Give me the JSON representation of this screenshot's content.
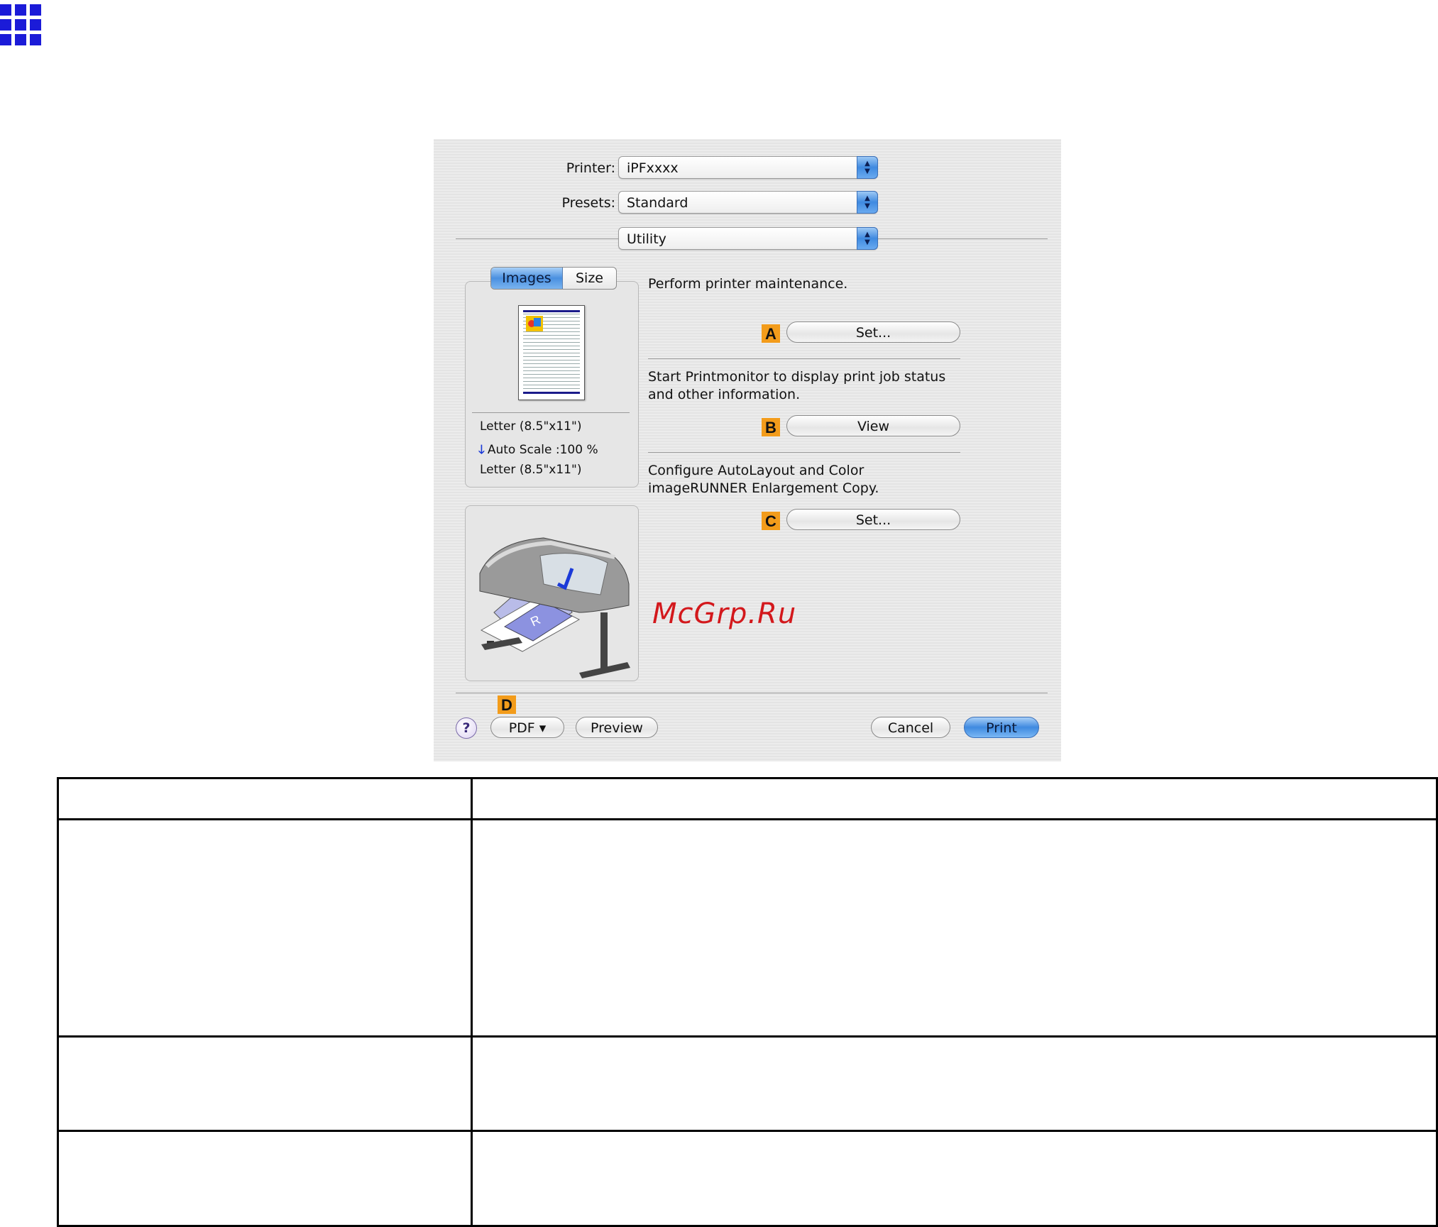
{
  "dialog": {
    "printer_label": "Printer:",
    "printer_value": "iPFxxxx",
    "presets_label": "Presets:",
    "presets_value": "Standard",
    "panel_value": "Utility",
    "tabs": [
      "Images",
      "Size"
    ],
    "preview": {
      "paper_in": "Letter (8.5\"x11\")",
      "scale": "Auto Scale :100 %",
      "paper_out": "Letter (8.5\"x11\")"
    },
    "sections": [
      {
        "tag": "A",
        "description": "Perform printer maintenance.",
        "button": "Set..."
      },
      {
        "tag": "B",
        "description": "Start Printmonitor to display print job status and other information.",
        "button": "View"
      },
      {
        "tag": "C",
        "description": "Configure AutoLayout and Color imageRUNNER Enlargement Copy.",
        "button": "Set..."
      }
    ],
    "footer": {
      "help": "?",
      "tag": "D",
      "pdf": "PDF ▾",
      "preview": "Preview",
      "cancel": "Cancel",
      "print": "Print"
    },
    "watermark": "McGrp.Ru"
  },
  "icons": {
    "app_grid": "grid-icon",
    "stepper": "popup-stepper-icon",
    "arrow": "arrow-down-icon",
    "printer": "printer-illustration-icon"
  },
  "colors": {
    "accent_blue": "#3f8ae0",
    "tag_orange": "#f39c1b",
    "grid_blue": "#1b1bd8"
  }
}
